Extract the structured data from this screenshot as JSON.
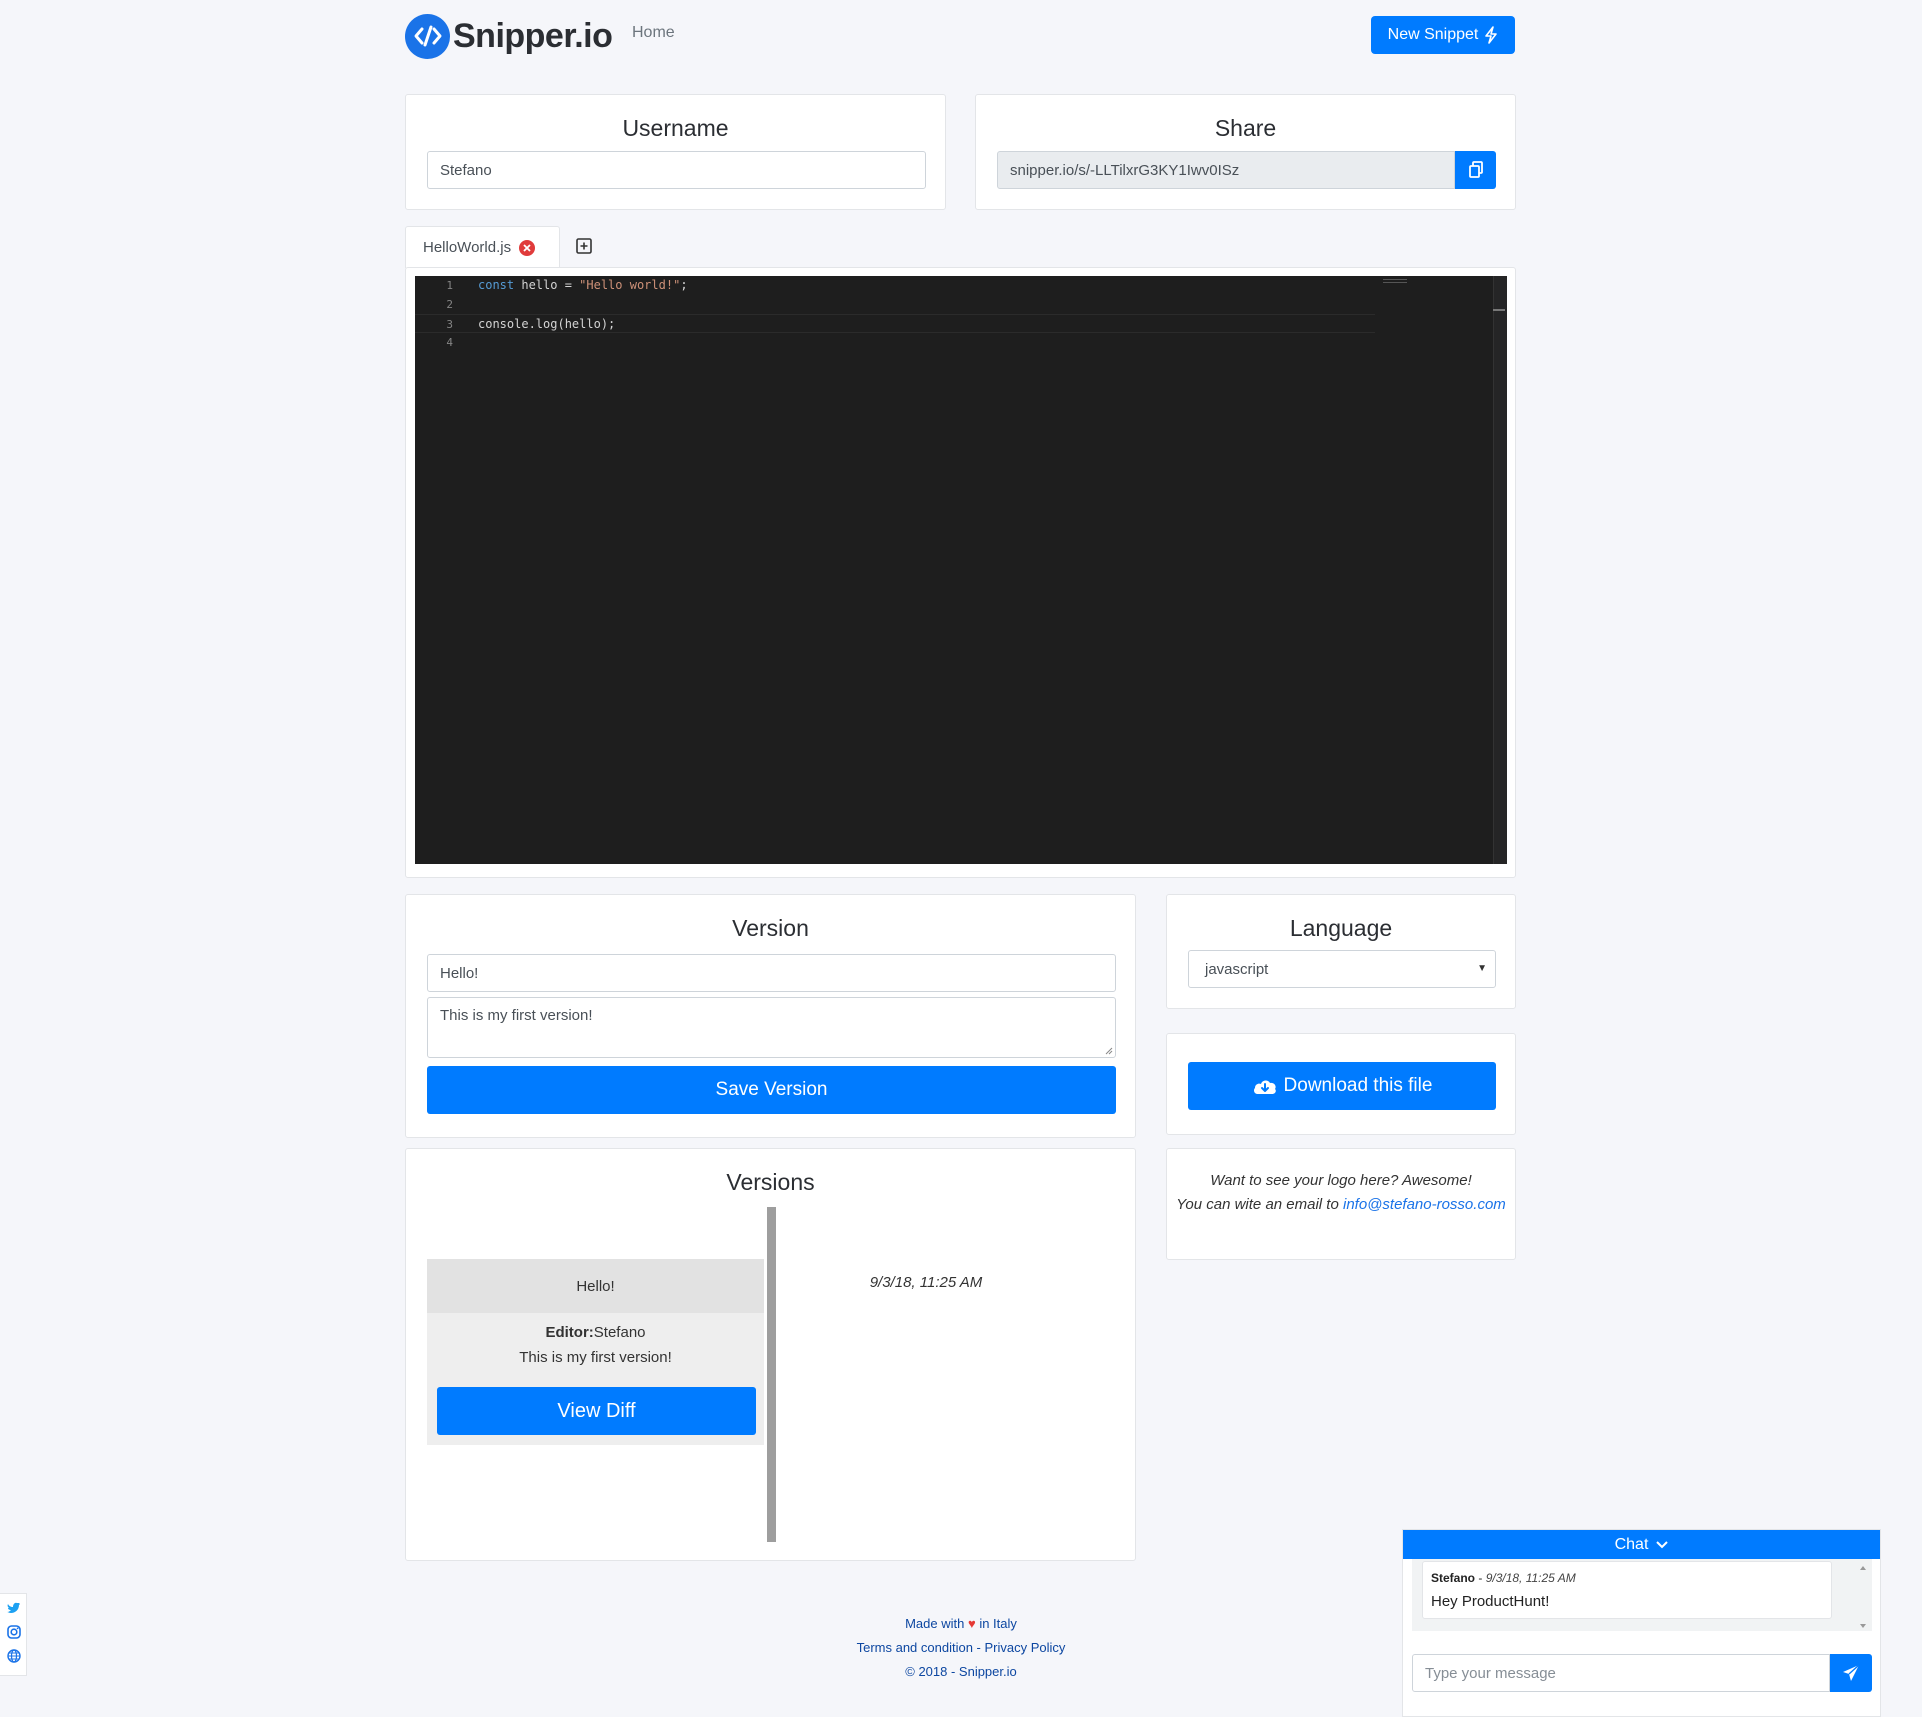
{
  "navbar": {
    "brand": "Snipper.io",
    "home": "Home",
    "new_snippet": "New Snippet"
  },
  "username_card": {
    "title": "Username",
    "value": "Stefano"
  },
  "share_card": {
    "title": "Share",
    "value": "snipper.io/s/-LLTilxrG3KY1Iwv0ISz"
  },
  "tabs": [
    {
      "label": "HelloWorld.js"
    }
  ],
  "editor": {
    "lines": [
      {
        "num": "1",
        "kw": "const",
        "rest_a": " hello = ",
        "str": "\"Hello world!\"",
        "rest_b": ";"
      },
      {
        "num": "2",
        "text": ""
      },
      {
        "num": "3",
        "text": "console.log(hello);"
      },
      {
        "num": "4",
        "text": ""
      }
    ]
  },
  "version_card": {
    "title": "Version",
    "name_value": "Hello!",
    "desc_value": "This is my first version!",
    "save_label": "Save Version"
  },
  "language_card": {
    "title": "Language",
    "selected": "javascript"
  },
  "download_card": {
    "label": "Download this file"
  },
  "promo": {
    "line1": "Want to see your logo here? Awesome!",
    "line2": "You can wite an email to ",
    "email": "info@stefano-rosso.com"
  },
  "versions_card": {
    "title": "Versions",
    "items": [
      {
        "name": "Hello!",
        "editor_label": "Editor:",
        "editor": "Stefano",
        "desc": "This is my first version!",
        "button": "View Diff",
        "date": "9/3/18, 11:25 AM"
      }
    ]
  },
  "footer": {
    "made_with": "Made with",
    "heart": "♥",
    "in_italy": "in Italy",
    "links": "Terms and condition - Privacy Policy",
    "copyright": "© 2018 - Snipper.io"
  },
  "chat": {
    "title": "Chat",
    "messages": [
      {
        "author": "Stefano",
        "sep": " - ",
        "time": "9/3/18, 11:25 AM",
        "text": "Hey ProductHunt!"
      }
    ],
    "placeholder": "Type your message"
  },
  "colors": {
    "primary": "#007bff",
    "editor_bg": "#1e1e1e",
    "page_bg": "#f5f6fa"
  }
}
